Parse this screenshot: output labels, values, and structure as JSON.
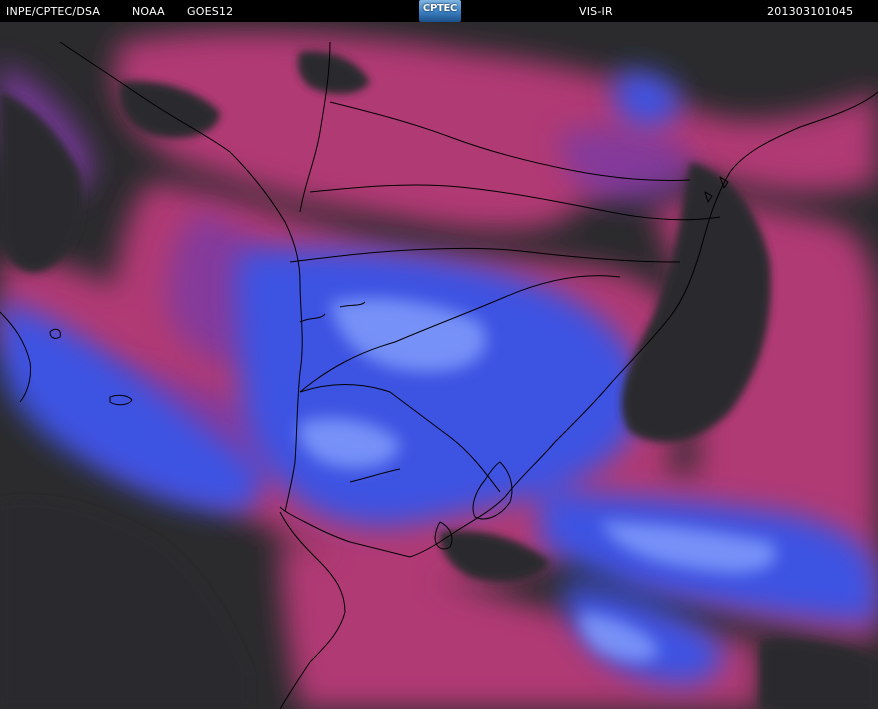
{
  "header": {
    "organization": "INPE/CPTEC/DSA",
    "agency": "NOAA",
    "satellite": "GOES12",
    "logo_text": "CPTEC",
    "product": "VIS-IR",
    "timestamp": "201303101045"
  },
  "colors": {
    "background": "#000000",
    "clear_sky": "#2a2a2c",
    "warm_cloud": "#c0407a",
    "mid_cloud": "#8a3c9a",
    "cold_cloud": "#3f55e6",
    "bright_cloud": "#8aa8ff",
    "boundaries": "#000000"
  },
  "map": {
    "type": "satellite-image",
    "overlay": "political-boundaries"
  }
}
